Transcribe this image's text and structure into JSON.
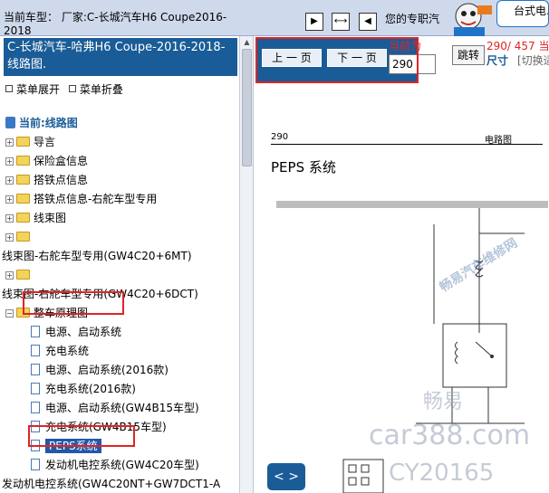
{
  "topbar": {
    "vehicle_label": "当前车型：  厂家:C-长城汽车H6 Coupe2016-2018",
    "welcome": "您的专职汽车维修",
    "model_box": "台式电..."
  },
  "left_panel": {
    "title": "C-长城汽车-哈弗H6 Coupe-2016-2018- 线路图.",
    "expand_menu": "菜单展开",
    "collapse_menu": "菜单折叠",
    "tree": {
      "root": "当前:线路图",
      "items": [
        "导言",
        "保险盒信息",
        "搭铁点信息",
        "搭铁点信息-右舵车型专用",
        "线束图",
        "线束图-右舵车型专用(GW4C20+6MT)",
        "线束图-右舵车型专用(GW4C20+6DCT)",
        "整车原理图"
      ],
      "children": [
        "电源、启动系统",
        "充电系统",
        "电源、启动系统(2016款)",
        "充电系统(2016款)",
        "电源、启动系统(GW4B15车型)",
        "充电系统(GW4B15车型)",
        "PEPS系统",
        "发动机电控系统(GW4C20车型)",
        "发动机电控系统(GW4C20NT+GW7DCT1-A"
      ]
    }
  },
  "right_panel": {
    "prev_label": "上 一 页",
    "next_label": "下 一 页",
    "current_label": "当前为",
    "page_value": "290",
    "jump_label": "跳转",
    "page_count": "290/ 457",
    "current_suffix": "当前",
    "size_label": "尺寸",
    "toggle_label": "[切换适应尺寸]",
    "doc_page_number": "290",
    "doc_section": "电路图",
    "doc_title": "PEPS 系统",
    "watermarks": [
      "畅易",
      "car388.com",
      "CY20165",
      "畅易汽车维修网"
    ],
    "nav_arrows": "< >"
  },
  "colors": {
    "accent": "#1a5c97",
    "highlight": "#e02424",
    "selected": "#2358a8"
  }
}
